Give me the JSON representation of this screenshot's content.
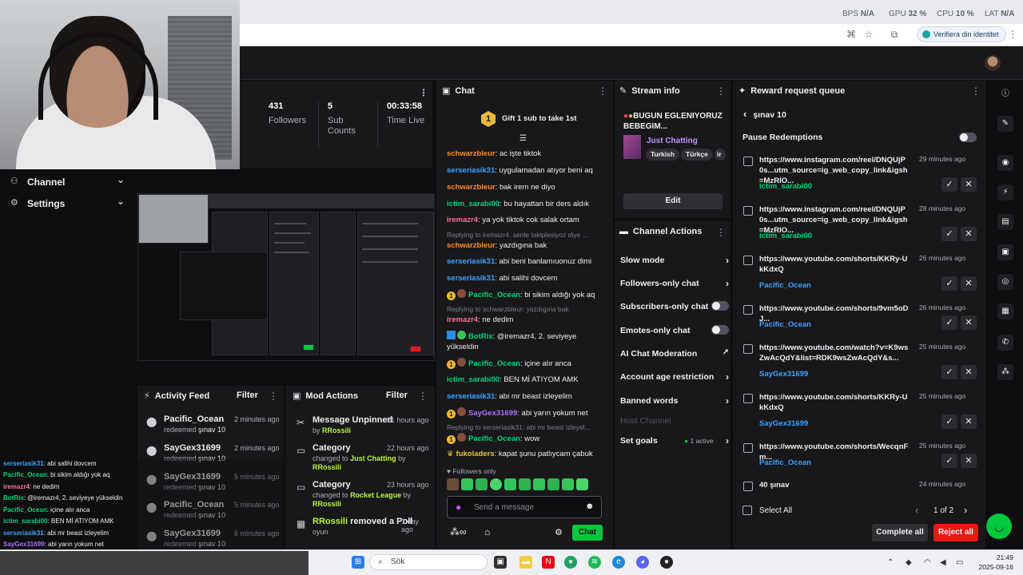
{
  "browser": {
    "stats": [
      {
        "label": "BPS",
        "value": "N/A"
      },
      {
        "label": "GPU",
        "value": "32 %"
      },
      {
        "label": "CPU",
        "value": "10 %"
      },
      {
        "label": "LAT",
        "value": "N/A"
      }
    ],
    "verify_label": "Verifiera din identitet"
  },
  "left_nav": {
    "items": [
      {
        "label": "Channel",
        "icon": "people-icon"
      },
      {
        "label": "Settings",
        "icon": "gear-icon"
      }
    ]
  },
  "stats_card": {
    "followers_value": "431",
    "followers_label": "Followers",
    "subs_value": "5",
    "subs_label": "Sub Counts",
    "time_value": "00:33:58",
    "time_label": "Time Live"
  },
  "activity_feed": {
    "title": "Activity Feed",
    "filter": "Filter",
    "items": [
      {
        "user": "Pacific_Ocean",
        "action": "redeemed",
        "reward": "şınav 10",
        "time": "2 minutes ago"
      },
      {
        "user": "SayGex31699",
        "action": "redeemed",
        "reward": "şınav 10",
        "time": "2 minutes ago"
      },
      {
        "user": "SayGex31699",
        "action": "redeemed",
        "reward": "şınav 10",
        "time": "5 minutes ago"
      },
      {
        "user": "Pacific_Ocean",
        "action": "redeemed",
        "reward": "şınav 10",
        "time": "5 minutes ago"
      },
      {
        "user": "SayGex31699",
        "action": "redeemed",
        "reward": "şınav 10",
        "time": "6 minutes ago"
      }
    ]
  },
  "mod_actions": {
    "title": "Mod Actions",
    "filter": "Filter",
    "items": [
      {
        "title": "Message Unpinned",
        "time": "21 hours ago",
        "line1": "by",
        "by": "RRossili",
        "line2": ""
      },
      {
        "title": "Category",
        "time": "22 hours ago",
        "line1": "changed to",
        "target": "Just Chatting",
        "by_word": "by",
        "by": "RRossili"
      },
      {
        "title": "Category",
        "time": "23 hours ago",
        "line1": "changed to",
        "target": "Rocket League",
        "by_word": "by",
        "by": "RRossili"
      },
      {
        "title_user": "RRossili",
        "title_rest": "removed a Poll",
        "time": "1 day ago",
        "sub": "oyun"
      }
    ]
  },
  "chat": {
    "title": "Chat",
    "gift_badge": "1",
    "gift_text": "Gift 1 sub to take 1st",
    "messages": [
      {
        "user": "schwarzbleur",
        "color": "c-orange",
        "text": ": ac işte tiktok"
      },
      {
        "user": "serseriasik31",
        "color": "c-blue",
        "text": ": uygulamadan atıyor beni aq"
      },
      {
        "user": "schwarzbleur",
        "color": "c-orange",
        "text": ": bak irem ne diyo"
      },
      {
        "user": "ictim_sarabi00",
        "color": "c-green",
        "text": ": bu hayattan bir ders aldık"
      },
      {
        "user": "iremazr4",
        "color": "c-pink",
        "text": ": ya yok tiktok cok salak ortam"
      },
      {
        "reply": "Replying to iremazr4: senle takiplesiyoz diye ..."
      },
      {
        "user": "schwarzbleur",
        "color": "c-orange",
        "text": ": yazdıgına bak"
      },
      {
        "user": "serseriasik31",
        "color": "c-blue",
        "text": ": abi beni banlamıuonuz dimi"
      },
      {
        "user": "serseriasik31",
        "color": "c-blue",
        "text": ": abi salihi dovcem"
      },
      {
        "user": "Pacific_Ocean",
        "color": "c-green",
        "text": ": bi sikim aldığı yok aq",
        "badges": "gold-av"
      },
      {
        "reply": "Replying to schwarzbleur: yazdıgına bak"
      },
      {
        "user": "iremazr4",
        "color": "c-pink",
        "text": ": ne dedim"
      },
      {
        "user": "BotRix",
        "color": "c-green",
        "text": ": @iremazr4, 2. seviyeye yükseldin",
        "badges": "blue-green"
      },
      {
        "user": "Pacific_Ocean",
        "color": "c-green",
        "text": ": içine alır anca",
        "badges": "gold-av"
      },
      {
        "user": "ictim_sarabi00",
        "color": "c-green",
        "text": ": BEN Mİ ATIYOM AMK"
      },
      {
        "user": "serseriasik31",
        "color": "c-blue",
        "text": ": abi mr beast izleyelim"
      },
      {
        "user": "SayGex31699",
        "color": "c-purple",
        "text": ": abi yarın yokum net",
        "badges": "gold-av"
      },
      {
        "reply": "Replying to serseriasik31: abi mr beast izleyel..."
      },
      {
        "user": "Pacific_Ocean",
        "color": "c-green",
        "text": ": wow",
        "badges": "gold-av"
      },
      {
        "user": "fukoladers",
        "color": "c-yellow",
        "text": ": kapat şunu patlıycam çabuk",
        "badges": "crown"
      }
    ],
    "followers_only": "Followers only",
    "placeholder": "Send a message",
    "send": "Chat"
  },
  "stream_info": {
    "title": "Stream info",
    "stream_title": "BUGUN EGLENIYORUZ BEBEGIM...",
    "category": "Just Chatting",
    "tags": [
      "Turkish",
      "Türkçe",
      "ir"
    ],
    "edit": "Edit"
  },
  "channel_actions": {
    "title": "Channel Actions",
    "items": [
      {
        "label": "Slow mode",
        "kind": "arrow"
      },
      {
        "label": "Followers-only chat",
        "kind": "arrow"
      },
      {
        "label": "Subscribers-only chat",
        "kind": "toggle"
      },
      {
        "label": "Emotes-only chat",
        "kind": "toggle"
      },
      {
        "label": "AI Chat Moderation",
        "kind": "ext"
      },
      {
        "label": "Account age restriction",
        "kind": "arrow"
      },
      {
        "label": "Banned words",
        "kind": "arrow"
      },
      {
        "label": "Host Channel",
        "kind": "disabled"
      },
      {
        "label": "Set goals",
        "kind": "arrow",
        "extra": "1 active"
      }
    ]
  },
  "reward_queue": {
    "title": "Reward request queue",
    "back_label": "şınav 10",
    "pause_label": "Pause Redemptions",
    "items": [
      {
        "url": "https://www.instagram.com/reel/DNQUjP0s...utm_source=ig_web_copy_link&igsh=MzRlO...",
        "time": "29 minutes ago",
        "user": "ictim_sarabi00",
        "color": "c-green"
      },
      {
        "url": "https://www.instagram.com/reel/DNQUjP0s...utm_source=ig_web_copy_link&igsh=MzRlO...",
        "time": "28 minutes ago",
        "user": "ictim_sarabi00",
        "color": "c-green"
      },
      {
        "url": "https://www.youtube.com/shorts/KKRy-UkKdxQ",
        "time": "26 minutes ago",
        "user": "Pacific_Ocean",
        "color": "c-blue"
      },
      {
        "url": "https://www.youtube.com/shorts/9vm5oDJ...",
        "time": "26 minutes ago",
        "user": "Pacific_Ocean",
        "color": "c-blue"
      },
      {
        "url": "https://www.youtube.com/watch?v=K9wsZwAcQdY&list=RDK9wsZwAcQdY&s...",
        "time": "25 minutes ago",
        "user": "SayGex31699",
        "color": "c-blue"
      },
      {
        "url": "https://www.youtube.com/shorts/KKRy-UkKdxQ",
        "time": "25 minutes ago",
        "user": "SayGex31699",
        "color": "c-blue"
      },
      {
        "url": "https://www.youtube.com/shorts/WecqnFm...",
        "time": "25 minutes ago",
        "user": "Pacific_Ocean",
        "color": "c-blue"
      },
      {
        "url": "40 şınav",
        "time": "24 minutes ago",
        "user": "",
        "color": "c-blue"
      }
    ],
    "select_all": "Select All",
    "page": "1 of 2",
    "complete_all": "Complete all",
    "reject_all": "Reject all"
  },
  "overlay_chat": [
    {
      "user": "serseriasik31",
      "color": "c-blue",
      "text": ": abi salihi dovcem"
    },
    {
      "user": "Pacific_Ocean",
      "color": "c-green",
      "text": ": bi sikim aldığı yok aq"
    },
    {
      "user": "iremazr4",
      "color": "c-pink",
      "text": ": ne dedim"
    },
    {
      "user": "BotRix",
      "color": "c-green",
      "text": ": @iremazr4, 2. seviyeye yükseldin"
    },
    {
      "user": "Pacific_Ocean",
      "color": "c-green",
      "text": ": içine alır anca"
    },
    {
      "user": "ictim_sarabi00",
      "color": "c-green",
      "text": ": BEN Mİ ATIYOM AMK"
    },
    {
      "user": "serseriasik31",
      "color": "c-blue",
      "text": ": abi mr beast izleyelim"
    },
    {
      "user": "SayGex31699",
      "color": "c-purple",
      "text": ": abi yarın yokum net"
    },
    {
      "user": "Pacific_Ocean",
      "color": "c-green",
      "text": ": wow"
    },
    {
      "user": "fukoladers",
      "color": "c-yellow",
      "text": ": kapat şunu patlıycam çabuk"
    }
  ],
  "taskbar": {
    "search": "Sök",
    "time": "21:49",
    "date": "2025-09-16"
  },
  "colors": {
    "accent_green": "#00c83c",
    "reject_red": "#e91916",
    "twitch_purple": "#9147ff"
  }
}
